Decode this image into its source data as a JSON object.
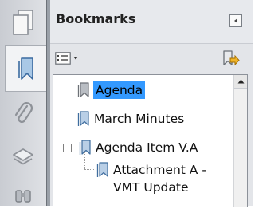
{
  "panel": {
    "title": "Bookmarks"
  },
  "rail": {
    "buttons": [
      {
        "name": "page-thumbnails",
        "icon": "pages-icon",
        "active": false
      },
      {
        "name": "bookmarks",
        "icon": "bookmark-icon",
        "active": true
      },
      {
        "name": "attachments",
        "icon": "paperclip-icon",
        "active": false
      },
      {
        "name": "layers",
        "icon": "layers-icon",
        "active": false
      },
      {
        "name": "search",
        "icon": "binoculars-icon",
        "active": false
      }
    ]
  },
  "toolbar": {
    "options_icon": "options-list-icon",
    "new_bookmark_icon": "new-bookmark-icon"
  },
  "bookmarks": [
    {
      "label": "Agenda",
      "level": 0,
      "selected": true
    },
    {
      "label": "March Minutes",
      "level": 0,
      "selected": false
    },
    {
      "label": "Agenda Item  V.A",
      "level": 0,
      "expanded": true,
      "selected": false
    },
    {
      "label_line1": "Attachment A -",
      "label_line2": "VMT Update",
      "level": 1,
      "selected": false
    }
  ],
  "colors": {
    "selection": "#3399ff",
    "rail_bg": "#d4d7dc",
    "panel_bg": "#e3e5e9"
  }
}
